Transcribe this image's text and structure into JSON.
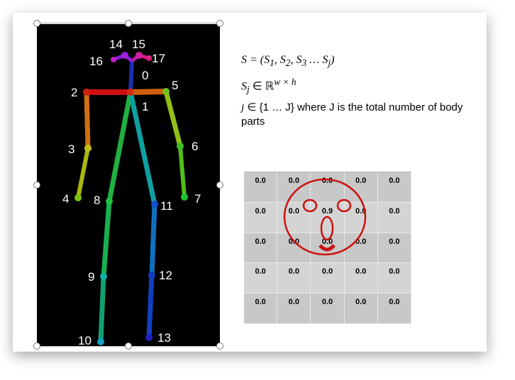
{
  "keypoints": {
    "k0": "0",
    "k1": "1",
    "k2": "2",
    "k3": "3",
    "k4": "4",
    "k5": "5",
    "k6": "6",
    "k7": "7",
    "k8": "8",
    "k9": "9",
    "k10": "10",
    "k11": "11",
    "k12": "12",
    "k13": "13",
    "k14": "14",
    "k15": "15",
    "k16": "16",
    "k17": "17"
  },
  "formulas": {
    "line1_a": "S = (S",
    "line1_b": "1",
    "line1_c": ", S",
    "line1_d": "2",
    "line1_e": ", S",
    "line1_f": "3",
    "line1_g": " … S",
    "line1_h": "j",
    "line1_i": ")",
    "line2_a": "S",
    "line2_b": "j",
    "line2_c": " ∈ ℝ",
    "line2_d": "w × h"
  },
  "description": {
    "var": "j",
    "text": " ∈ {1 … J} where J is the total number of body parts"
  },
  "heatmap": {
    "r0": [
      "0.0",
      "0.0",
      "0.0",
      "0.0",
      "0.0"
    ],
    "r1": [
      "0.0",
      "0.0",
      "0.9",
      "0.0",
      "0.0"
    ],
    "r2": [
      "0.0",
      "0.0",
      "0.0",
      "0.0",
      "0.0"
    ],
    "r3": [
      "0.0",
      "0.0",
      "0.0",
      "0.0",
      "0.0"
    ],
    "r4": [
      "0.0",
      "0.0",
      "0.0",
      "0.0",
      "0.0"
    ]
  },
  "colors": {
    "face": "#cc1111",
    "cell_bg": "#c8c8c8"
  }
}
